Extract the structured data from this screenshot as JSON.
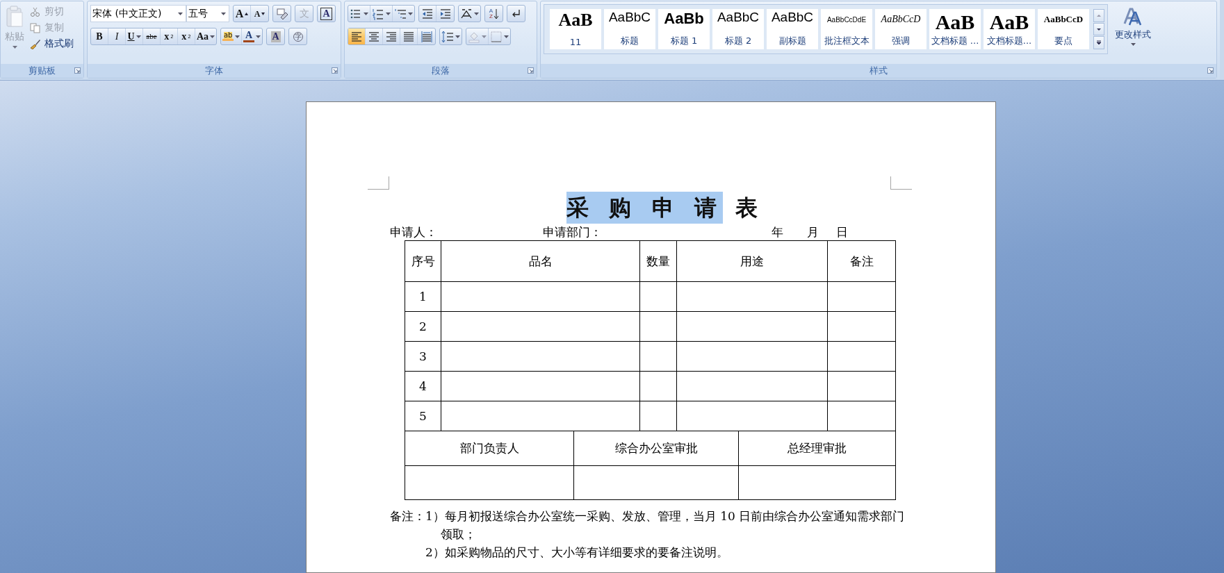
{
  "ribbon": {
    "clipboard": {
      "label": "剪贴板",
      "paste": {
        "label": "粘贴",
        "disabled": true
      },
      "actions": [
        {
          "kind": "cut",
          "label": "剪切",
          "disabled": true
        },
        {
          "kind": "copy",
          "label": "复制",
          "disabled": true
        },
        {
          "kind": "painter",
          "label": "格式刷",
          "disabled": false
        }
      ]
    },
    "font": {
      "label": "字体",
      "font_name": "宋体 (中文正文)",
      "font_size": "五号",
      "row1": [
        [
          {
            "kind": "grow",
            "glyph": "A"
          },
          {
            "kind": "shrink",
            "glyph": "A"
          }
        ],
        [
          {
            "kind": "clear"
          }
        ],
        [
          {
            "kind": "phonetic",
            "glyph": "文",
            "disabled": true
          }
        ],
        [
          {
            "kind": "border",
            "glyph": "A"
          }
        ]
      ],
      "row2": [
        [
          {
            "kind": "bold",
            "glyph": "B"
          },
          {
            "kind": "italic",
            "glyph": "I"
          },
          {
            "kind": "underline",
            "glyph": "U",
            "dropdown": true
          },
          {
            "kind": "strike",
            "glyph": "abe"
          },
          {
            "kind": "sub",
            "glyph": "x",
            "script": "2"
          },
          {
            "kind": "sup",
            "glyph": "x",
            "script": "2"
          },
          {
            "kind": "case",
            "glyph": "Aa",
            "dropdown": true
          }
        ],
        [
          {
            "kind": "highlight",
            "glyph": "ab",
            "color": "#f5b25a",
            "dropdown": true
          },
          {
            "kind": "fontcolor",
            "glyph": "A",
            "color": "#a1461a",
            "dropdown": true
          }
        ],
        [
          {
            "kind": "shading",
            "glyph": "A"
          }
        ],
        [
          {
            "kind": "enclose",
            "glyph": "字"
          }
        ]
      ]
    },
    "paragraph": {
      "label": "段落",
      "row1": [
        [
          {
            "kind": "bullets",
            "dropdown": true
          },
          {
            "kind": "numbering",
            "dropdown": true
          },
          {
            "kind": "multilevel",
            "dropdown": true
          }
        ],
        [
          {
            "kind": "outdent"
          },
          {
            "kind": "indent"
          }
        ],
        [
          {
            "kind": "asian",
            "dropdown": true
          }
        ],
        [
          {
            "kind": "sort",
            "glyph": "A",
            "script": "Z"
          }
        ],
        [
          {
            "kind": "marks"
          }
        ]
      ],
      "row2": [
        [
          {
            "kind": "align-left",
            "selected": true
          },
          {
            "kind": "align-center",
            "selected": false
          },
          {
            "kind": "align-right",
            "selected": false
          },
          {
            "kind": "justify",
            "selected": false
          },
          {
            "kind": "distribute",
            "selected": false
          }
        ],
        [
          {
            "kind": "spacing",
            "dropdown": true
          }
        ],
        [
          {
            "kind": "fill",
            "dropdown": true,
            "disabled": true
          },
          {
            "kind": "borders",
            "dropdown": true
          }
        ]
      ]
    },
    "styles": {
      "label": "样式",
      "items": [
        {
          "preview": "AaB",
          "label": "11",
          "kind": "serif-bold"
        },
        {
          "preview": "AaBbC",
          "label": "标题",
          "kind": "sans"
        },
        {
          "preview": "AaBb",
          "label": "标题 1",
          "kind": "sans-bold"
        },
        {
          "preview": "AaBbC",
          "label": "标题 2",
          "kind": "sans"
        },
        {
          "preview": "AaBbC",
          "label": "副标题",
          "kind": "sans"
        },
        {
          "preview": "AaBbCcDdE",
          "label": "批注框文本",
          "kind": "small"
        },
        {
          "preview": "AaBbCcD",
          "label": "强调",
          "kind": "italic"
        },
        {
          "preview": "AaB",
          "label": "文档标题 ...",
          "kind": "serif-bold-large"
        },
        {
          "preview": "AaB",
          "label": "文档标题...",
          "kind": "serif-bold-large"
        },
        {
          "preview": "AaBbCcD",
          "label": "要点",
          "kind": "serif-bold-small"
        }
      ],
      "change_styles": "更改样式"
    }
  },
  "document": {
    "title": [
      {
        "text": "采 购 申 请",
        "selected": true
      },
      {
        "text": "表",
        "selected": false
      }
    ],
    "header": {
      "applicant": "申请人：",
      "department": "申请部门：",
      "year": "年",
      "month": "月",
      "day": "日"
    },
    "table": {
      "columns": [
        "序号",
        "品名",
        "数量",
        "用途",
        "备注"
      ],
      "rows": [
        {
          "number": "1"
        },
        {
          "number": "2"
        },
        {
          "number": "3"
        },
        {
          "number": "4"
        },
        {
          "number": "5"
        }
      ],
      "signoff": [
        "部门负责人",
        "综合办公室审批",
        "总经理审批"
      ]
    },
    "notes": {
      "label": "备注：",
      "items": [
        "1）每月初报送综合办公室统一采购、发放、管理，当月 10 日前由综合办公室通知需求部门领取；",
        "2）如采购物品的尺寸、大小等有详细要求的要备注说明。"
      ]
    }
  }
}
